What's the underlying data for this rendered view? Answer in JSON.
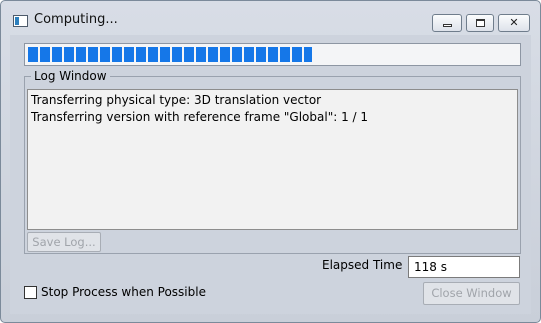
{
  "window": {
    "title": "Computing..."
  },
  "progress": {
    "fraction": 0.58,
    "color": "#1577e8"
  },
  "log": {
    "group_title": "Log Window",
    "lines": [
      "Transferring physical type: 3D translation vector",
      "Transferring version with reference frame \"Global\": 1 / 1"
    ],
    "save_label": "Save Log..."
  },
  "elapsed": {
    "label": "Elapsed Time",
    "value": "118 s"
  },
  "stop": {
    "label": "Stop Process when Possible",
    "checked": false
  },
  "close_label": "Close Window"
}
